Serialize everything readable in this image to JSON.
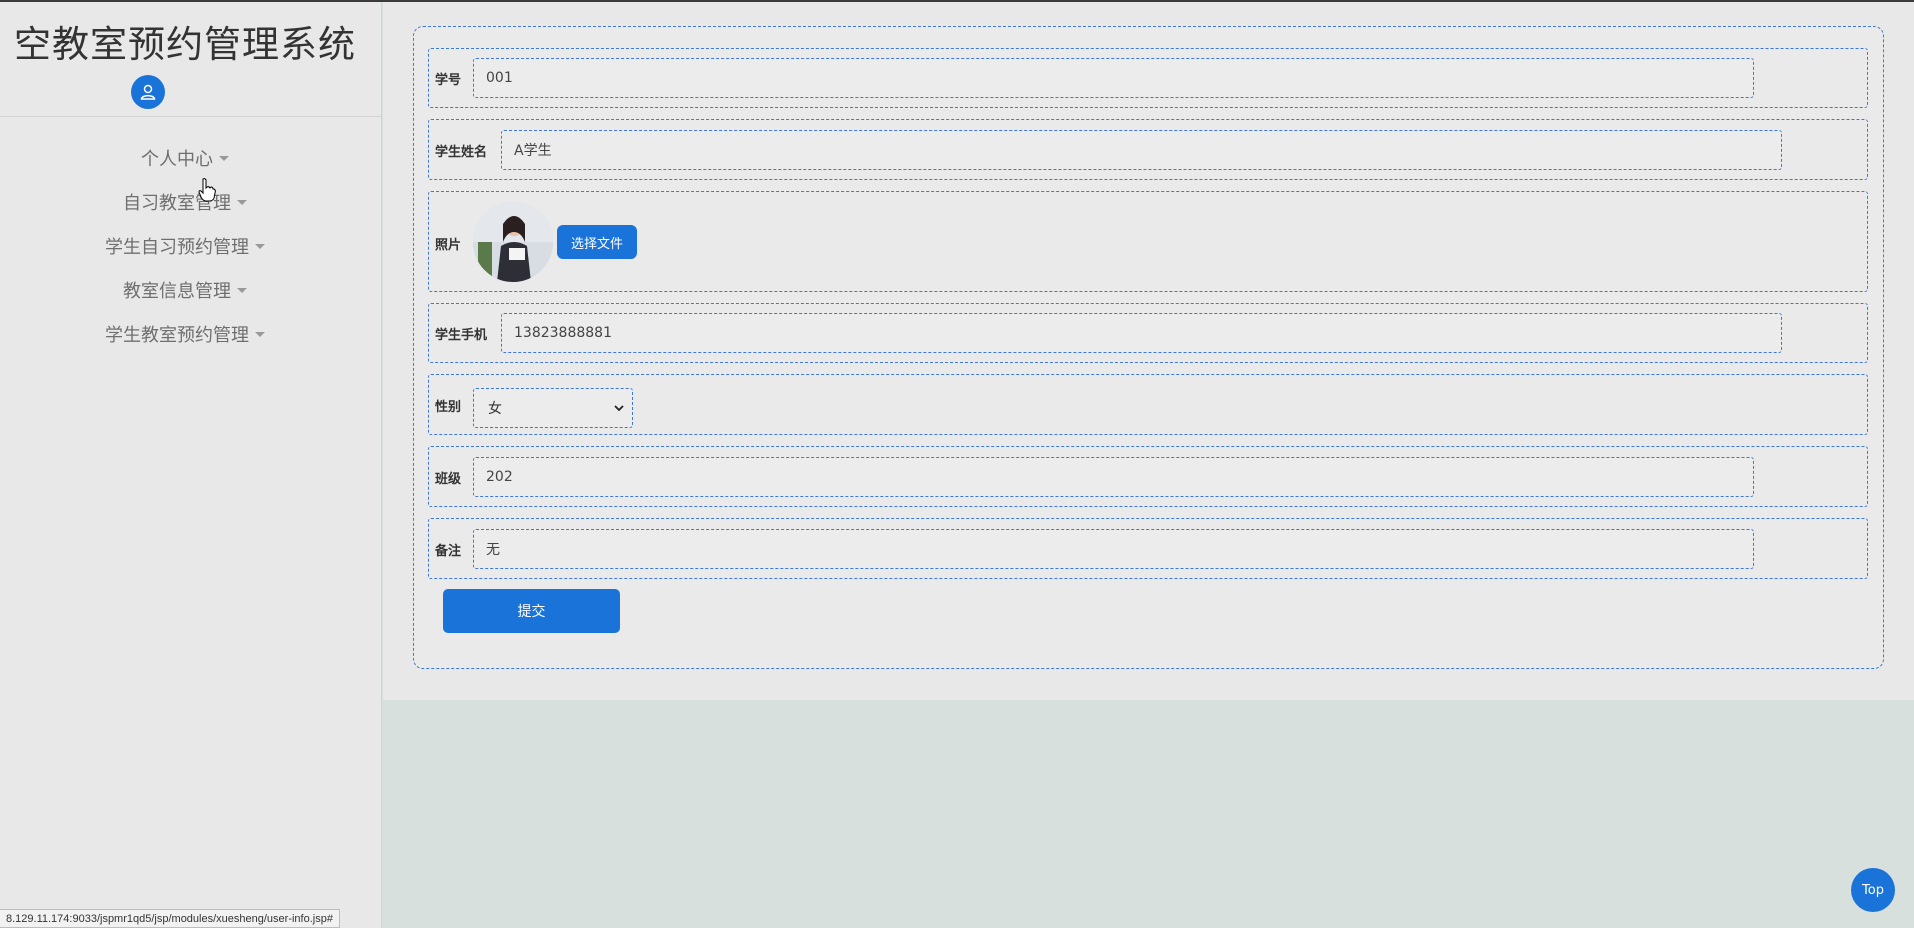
{
  "app": {
    "title": "空教室预约管理系统"
  },
  "sidebar": {
    "avatar_icon": "user-icon",
    "items": [
      {
        "label": "个人中心"
      },
      {
        "label": "自习教室管理"
      },
      {
        "label": "学生自习预约管理"
      },
      {
        "label": "教室信息管理"
      },
      {
        "label": "学生教室预约管理"
      }
    ]
  },
  "form": {
    "student_id": {
      "label": "学号",
      "value": "001"
    },
    "student_name": {
      "label": "学生姓名",
      "value": "A学生"
    },
    "photo": {
      "label": "照片",
      "button_label": "选择文件"
    },
    "phone": {
      "label": "学生手机",
      "value": "13823888881"
    },
    "gender": {
      "label": "性别",
      "selected": "女"
    },
    "class": {
      "label": "班级",
      "value": "202"
    },
    "remark": {
      "label": "备注",
      "value": "无"
    },
    "submit_label": "提交"
  },
  "top_button": {
    "label": "Top"
  },
  "status_bar": {
    "url": "8.129.11.174:9033/jspmr1qd5/jsp/modules/xuesheng/user-info.jsp#"
  },
  "colors": {
    "accent": "#1a73d8",
    "border": "#3d78d6",
    "background": "#e9e8e8"
  }
}
